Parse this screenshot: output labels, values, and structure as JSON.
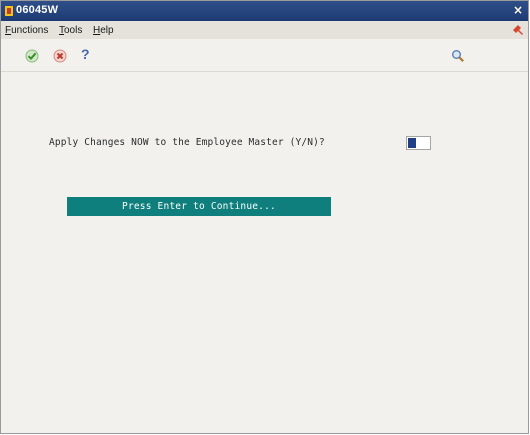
{
  "window": {
    "title": "06045W",
    "close_glyph": "×"
  },
  "menu": {
    "items": [
      "Functions",
      "Tools",
      "Help"
    ]
  },
  "toolbar": {
    "icons": [
      "check-icon",
      "cancel-icon",
      "help-icon",
      "search-icon"
    ],
    "help_glyph": "?"
  },
  "form": {
    "prompt": "Apply Changes NOW to the Employee Master (Y/N)?",
    "answer_value": ""
  },
  "continue_bar": {
    "label": "Press Enter to Continue..."
  },
  "colors": {
    "titlebar": "#1e3a73",
    "continue_bar": "#0e7f7c",
    "background": "#f2f1ee"
  }
}
